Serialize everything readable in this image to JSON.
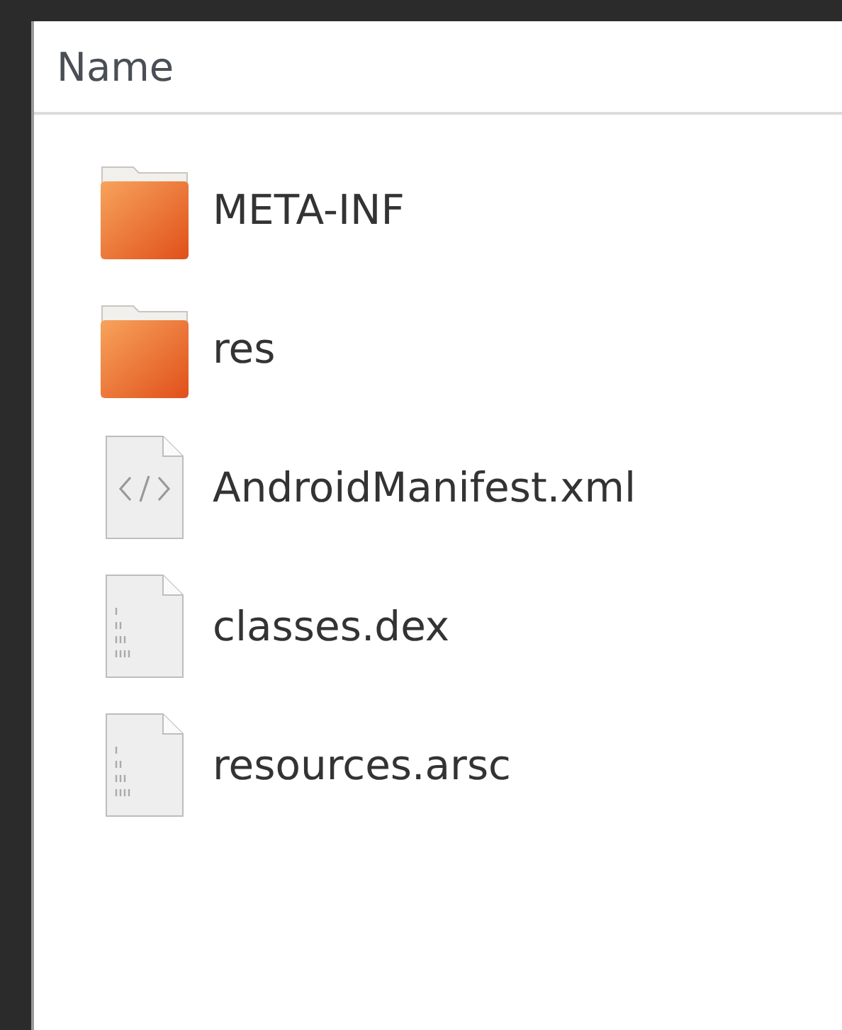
{
  "table": {
    "columns": [
      {
        "label": "Name"
      }
    ],
    "rows": [
      {
        "name": "META-INF",
        "kind": "folder"
      },
      {
        "name": "res",
        "kind": "folder"
      },
      {
        "name": "AndroidManifest.xml",
        "kind": "xml"
      },
      {
        "name": "classes.dex",
        "kind": "binary"
      },
      {
        "name": "resources.arsc",
        "kind": "binary"
      }
    ]
  }
}
